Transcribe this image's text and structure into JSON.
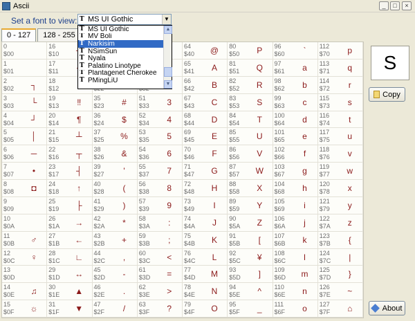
{
  "window": {
    "title": "Ascii",
    "min": "_",
    "max": "□",
    "close": "×"
  },
  "font_label": "Set a font to view:",
  "font_select": {
    "value": "MS UI Gothic",
    "arrow": "▼"
  },
  "tabs": [
    {
      "label": "0 - 127"
    },
    {
      "label": "128 - 255"
    }
  ],
  "dropdown": {
    "items": [
      {
        "label": "MS UI Gothic"
      },
      {
        "label": "MV Boli"
      },
      {
        "label": "Narkisim"
      },
      {
        "label": "NSimSun"
      },
      {
        "label": "Nyala"
      },
      {
        "label": "Palatino Linotype"
      },
      {
        "label": "Plantagenet Cherokee"
      },
      {
        "label": "PMingLiU"
      }
    ],
    "selected_index": 2,
    "scroll_up": "▲",
    "scroll_down": "▼"
  },
  "tt_icon_glyph": "T",
  "preview": {
    "glyph": "S"
  },
  "buttons": {
    "copy": "Copy",
    "about": "About"
  },
  "cells": [
    {
      "d": "0",
      "h": "$00",
      "g": ""
    },
    {
      "d": "16",
      "h": "$10",
      "g": "┼"
    },
    {
      "d": "32",
      "h": "$20",
      "g": ""
    },
    {
      "d": "48",
      "h": "$30",
      "g": "0"
    },
    {
      "d": "64",
      "h": "$40",
      "g": "@"
    },
    {
      "d": "80",
      "h": "$50",
      "g": "P"
    },
    {
      "d": "96",
      "h": "$60",
      "g": "`"
    },
    {
      "d": "112",
      "h": "$70",
      "g": "p"
    },
    {
      "d": "1",
      "h": "$01",
      "g": ""
    },
    {
      "d": "17",
      "h": "$11",
      "g": "◄"
    },
    {
      "d": "33",
      "h": "$21",
      "g": "!"
    },
    {
      "d": "49",
      "h": "$31",
      "g": "1"
    },
    {
      "d": "65",
      "h": "$41",
      "g": "A"
    },
    {
      "d": "81",
      "h": "$51",
      "g": "Q"
    },
    {
      "d": "97",
      "h": "$61",
      "g": "a"
    },
    {
      "d": "113",
      "h": "$71",
      "g": "q"
    },
    {
      "d": "2",
      "h": "$02",
      "g": "┐"
    },
    {
      "d": "18",
      "h": "$12",
      "g": "↕"
    },
    {
      "d": "34",
      "h": "$22",
      "g": "\""
    },
    {
      "d": "50",
      "h": "$32",
      "g": "2"
    },
    {
      "d": "66",
      "h": "$42",
      "g": "B"
    },
    {
      "d": "82",
      "h": "$52",
      "g": "R"
    },
    {
      "d": "98",
      "h": "$62",
      "g": "b"
    },
    {
      "d": "114",
      "h": "$72",
      "g": "r"
    },
    {
      "d": "3",
      "h": "$03",
      "g": "└"
    },
    {
      "d": "19",
      "h": "$13",
      "g": "‼"
    },
    {
      "d": "35",
      "h": "$23",
      "g": "#"
    },
    {
      "d": "51",
      "h": "$33",
      "g": "3"
    },
    {
      "d": "67",
      "h": "$43",
      "g": "C"
    },
    {
      "d": "83",
      "h": "$53",
      "g": "S"
    },
    {
      "d": "99",
      "h": "$63",
      "g": "c"
    },
    {
      "d": "115",
      "h": "$73",
      "g": "s"
    },
    {
      "d": "4",
      "h": "$04",
      "g": "┘"
    },
    {
      "d": "20",
      "h": "$14",
      "g": "¶"
    },
    {
      "d": "36",
      "h": "$24",
      "g": "$"
    },
    {
      "d": "52",
      "h": "$34",
      "g": "4"
    },
    {
      "d": "68",
      "h": "$44",
      "g": "D"
    },
    {
      "d": "84",
      "h": "$54",
      "g": "T"
    },
    {
      "d": "100",
      "h": "$64",
      "g": "d"
    },
    {
      "d": "116",
      "h": "$74",
      "g": "t"
    },
    {
      "d": "5",
      "h": "$05",
      "g": "│"
    },
    {
      "d": "21",
      "h": "$15",
      "g": "┴"
    },
    {
      "d": "37",
      "h": "$25",
      "g": "%"
    },
    {
      "d": "53",
      "h": "$35",
      "g": "5"
    },
    {
      "d": "69",
      "h": "$45",
      "g": "E"
    },
    {
      "d": "85",
      "h": "$55",
      "g": "U"
    },
    {
      "d": "101",
      "h": "$65",
      "g": "e"
    },
    {
      "d": "117",
      "h": "$75",
      "g": "u"
    },
    {
      "d": "6",
      "h": "$06",
      "g": "─"
    },
    {
      "d": "22",
      "h": "$16",
      "g": "┬"
    },
    {
      "d": "38",
      "h": "$26",
      "g": "&"
    },
    {
      "d": "54",
      "h": "$36",
      "g": "6"
    },
    {
      "d": "70",
      "h": "$46",
      "g": "F"
    },
    {
      "d": "86",
      "h": "$56",
      "g": "V"
    },
    {
      "d": "102",
      "h": "$66",
      "g": "f"
    },
    {
      "d": "118",
      "h": "$76",
      "g": "v"
    },
    {
      "d": "7",
      "h": "$07",
      "g": "•"
    },
    {
      "d": "23",
      "h": "$17",
      "g": "┤"
    },
    {
      "d": "39",
      "h": "$27",
      "g": "'"
    },
    {
      "d": "55",
      "h": "$37",
      "g": "7"
    },
    {
      "d": "71",
      "h": "$47",
      "g": "G"
    },
    {
      "d": "87",
      "h": "$57",
      "g": "W"
    },
    {
      "d": "103",
      "h": "$67",
      "g": "g"
    },
    {
      "d": "119",
      "h": "$77",
      "g": "w"
    },
    {
      "d": "8",
      "h": "$08",
      "g": "◘"
    },
    {
      "d": "24",
      "h": "$18",
      "g": "↑"
    },
    {
      "d": "40",
      "h": "$28",
      "g": "("
    },
    {
      "d": "56",
      "h": "$38",
      "g": "8"
    },
    {
      "d": "72",
      "h": "$48",
      "g": "H"
    },
    {
      "d": "88",
      "h": "$58",
      "g": "X"
    },
    {
      "d": "104",
      "h": "$68",
      "g": "h"
    },
    {
      "d": "120",
      "h": "$78",
      "g": "x"
    },
    {
      "d": "9",
      "h": "$09",
      "g": ""
    },
    {
      "d": "25",
      "h": "$19",
      "g": "├"
    },
    {
      "d": "41",
      "h": "$29",
      "g": ")"
    },
    {
      "d": "57",
      "h": "$39",
      "g": "9"
    },
    {
      "d": "73",
      "h": "$49",
      "g": "I"
    },
    {
      "d": "89",
      "h": "$59",
      "g": "Y"
    },
    {
      "d": "105",
      "h": "$69",
      "g": "i"
    },
    {
      "d": "121",
      "h": "$79",
      "g": "y"
    },
    {
      "d": "10",
      "h": "$0A",
      "g": ""
    },
    {
      "d": "26",
      "h": "$1A",
      "g": "→"
    },
    {
      "d": "42",
      "h": "$2A",
      "g": "*"
    },
    {
      "d": "58",
      "h": "$3A",
      "g": ":"
    },
    {
      "d": "74",
      "h": "$4A",
      "g": "J"
    },
    {
      "d": "90",
      "h": "$5A",
      "g": "Z"
    },
    {
      "d": "106",
      "h": "$6A",
      "g": "j"
    },
    {
      "d": "122",
      "h": "$7A",
      "g": "z"
    },
    {
      "d": "11",
      "h": "$0B",
      "g": "♂"
    },
    {
      "d": "27",
      "h": "$1B",
      "g": "←"
    },
    {
      "d": "43",
      "h": "$2B",
      "g": "+"
    },
    {
      "d": "59",
      "h": "$3B",
      "g": ";"
    },
    {
      "d": "75",
      "h": "$4B",
      "g": "K"
    },
    {
      "d": "91",
      "h": "$5B",
      "g": "["
    },
    {
      "d": "107",
      "h": "$6B",
      "g": "k"
    },
    {
      "d": "123",
      "h": "$7B",
      "g": "{"
    },
    {
      "d": "12",
      "h": "$0C",
      "g": "♀"
    },
    {
      "d": "28",
      "h": "$1C",
      "g": "∟"
    },
    {
      "d": "44",
      "h": "$2C",
      "g": ","
    },
    {
      "d": "60",
      "h": "$3C",
      "g": "<"
    },
    {
      "d": "76",
      "h": "$4C",
      "g": "L"
    },
    {
      "d": "92",
      "h": "$5C",
      "g": "¥"
    },
    {
      "d": "108",
      "h": "$6C",
      "g": "l"
    },
    {
      "d": "124",
      "h": "$7C",
      "g": "|"
    },
    {
      "d": "13",
      "h": "$0D",
      "g": ""
    },
    {
      "d": "29",
      "h": "$1D",
      "g": "↔"
    },
    {
      "d": "45",
      "h": "$2D",
      "g": "-"
    },
    {
      "d": "61",
      "h": "$3D",
      "g": "="
    },
    {
      "d": "77",
      "h": "$4D",
      "g": "M"
    },
    {
      "d": "93",
      "h": "$5D",
      "g": "]"
    },
    {
      "d": "109",
      "h": "$6D",
      "g": "m"
    },
    {
      "d": "125",
      "h": "$7D",
      "g": "}"
    },
    {
      "d": "14",
      "h": "$0E",
      "g": "♫"
    },
    {
      "d": "30",
      "h": "$1E",
      "g": "▲"
    },
    {
      "d": "46",
      "h": "$2E",
      "g": "."
    },
    {
      "d": "62",
      "h": "$3E",
      "g": ">"
    },
    {
      "d": "78",
      "h": "$4E",
      "g": "N"
    },
    {
      "d": "94",
      "h": "$5E",
      "g": "^"
    },
    {
      "d": "110",
      "h": "$6E",
      "g": "n"
    },
    {
      "d": "126",
      "h": "$7E",
      "g": "~"
    },
    {
      "d": "15",
      "h": "$0F",
      "g": "☼"
    },
    {
      "d": "31",
      "h": "$1F",
      "g": "▼"
    },
    {
      "d": "47",
      "h": "$2F",
      "g": "/"
    },
    {
      "d": "63",
      "h": "$3F",
      "g": "?"
    },
    {
      "d": "79",
      "h": "$4F",
      "g": "O"
    },
    {
      "d": "95",
      "h": "$5F",
      "g": "_"
    },
    {
      "d": "111",
      "h": "$6F",
      "g": "o"
    },
    {
      "d": "127",
      "h": "$7F",
      "g": "⌂"
    }
  ]
}
